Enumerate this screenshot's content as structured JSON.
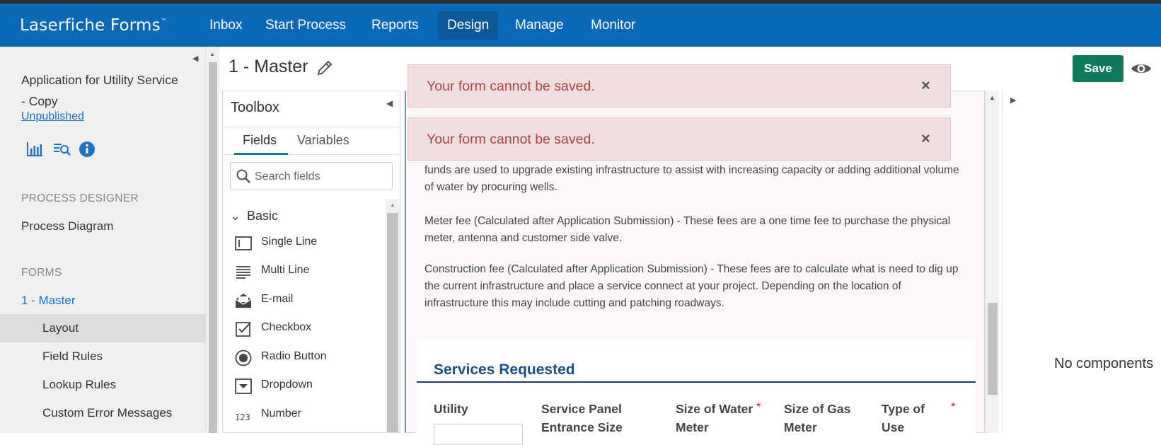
{
  "app": {
    "brand": "Laserfiche Forms",
    "trademark": "™"
  },
  "nav": {
    "items": [
      {
        "label": "Inbox"
      },
      {
        "label": "Start Process"
      },
      {
        "label": "Reports"
      },
      {
        "label": "Design",
        "active": true
      },
      {
        "label": "Manage"
      },
      {
        "label": "Monitor"
      }
    ]
  },
  "left_panel": {
    "form_title": "Application for Utility Service - Copy",
    "status_link": "Unpublished",
    "icons": [
      "bar-chart-icon",
      "search-list-icon",
      "info-icon"
    ],
    "process_designer_heading": "PROCESS DESIGNER",
    "process_diagram": "Process Diagram",
    "forms_heading": "FORMS",
    "current_form": "1 - Master",
    "sub_items": [
      {
        "label": "Layout",
        "active": true
      },
      {
        "label": "Field Rules"
      },
      {
        "label": "Lookup Rules"
      },
      {
        "label": "Custom Error Messages"
      }
    ]
  },
  "header": {
    "page_name": "1 - Master",
    "save_label": "Save"
  },
  "alerts": [
    {
      "message": "Your form cannot be saved.",
      "close": "×"
    },
    {
      "message": "Your form cannot be saved.",
      "close": "×"
    }
  ],
  "toolbox": {
    "title": "Toolbox",
    "tabs": [
      {
        "label": "Fields",
        "active": true
      },
      {
        "label": "Variables"
      }
    ],
    "search_placeholder": "Search fields",
    "group": "Basic",
    "items": [
      {
        "label": "Single Line",
        "icon": "single-line-icon"
      },
      {
        "label": "Multi Line",
        "icon": "multi-line-icon"
      },
      {
        "label": "E-mail",
        "icon": "email-icon"
      },
      {
        "label": "Checkbox",
        "icon": "checkbox-icon"
      },
      {
        "label": "Radio Button",
        "icon": "radio-button-icon"
      },
      {
        "label": "Dropdown",
        "icon": "dropdown-icon"
      },
      {
        "label": "Number",
        "icon": "number-icon"
      }
    ]
  },
  "canvas": {
    "paragraphs": [
      "funds are used to upgrade existing infrastructure to assist with increasing capacity or adding additional volume of water by procuring wells.",
      "Meter fee (Calculated after Application Submission) - These fees are a one time fee to purchase the physical meter, antenna and customer side valve.",
      "Construction fee (Calculated after Application Submission) - These fees are to calculate what is need to dig up the current infrastructure and place a service connect at your project. Depending on the location of infrastructure this may include cutting and patching roadways."
    ],
    "section_heading": "Services Requested",
    "columns": [
      {
        "label": "Utility",
        "required": false
      },
      {
        "label": "Service Panel Entrance Size",
        "required": false
      },
      {
        "label": "Size of Water Meter",
        "required": true
      },
      {
        "label": "Size of Gas Meter",
        "required": false
      },
      {
        "label": "Type of Use",
        "required": true
      }
    ],
    "required_mark": "*"
  },
  "right_panel": {
    "empty_text": "No components"
  },
  "colors": {
    "nav_bg": "#0a69b8",
    "save_bg": "#0a7a5a",
    "alert_bg": "#f2dede",
    "alert_text": "#a94442",
    "link": "#1a73c7",
    "section_heading": "#1a4f8b"
  }
}
